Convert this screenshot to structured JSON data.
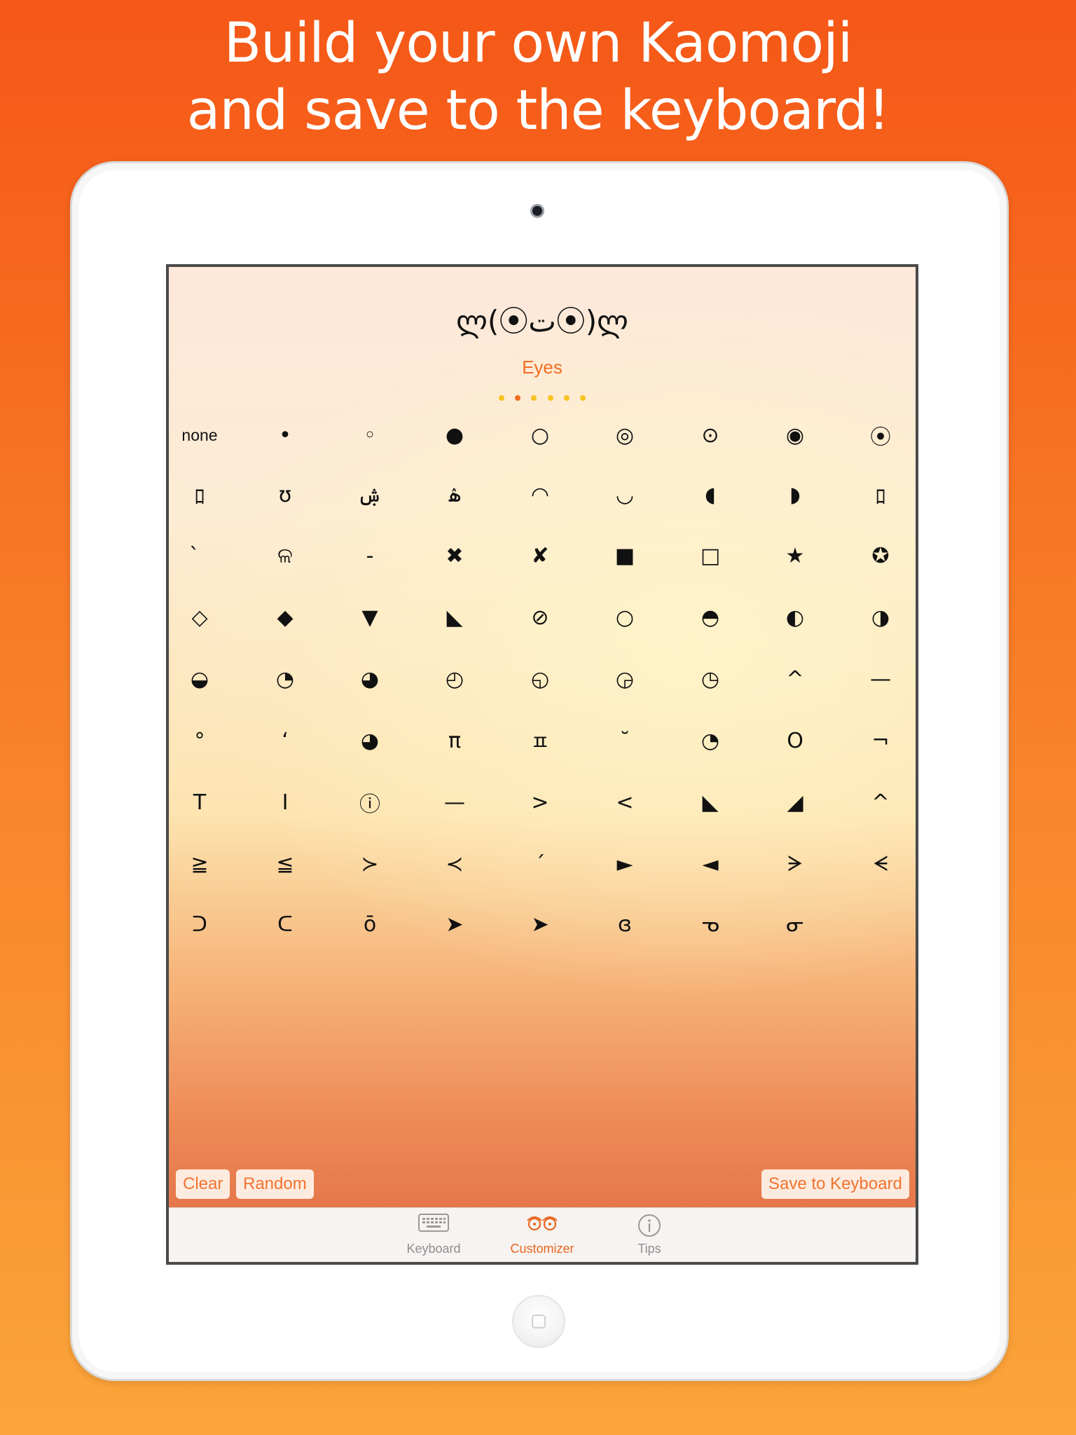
{
  "headline": {
    "line1": "Build your own Kaomoji",
    "line2": "and save to the keyboard!"
  },
  "preview_kaomoji": "ლ(⦿ت⦿)ლ",
  "section": {
    "label": "Eyes",
    "page_count": 6,
    "active_page_index": 1
  },
  "eyes": [
    [
      "none",
      "•",
      "◦",
      "●",
      "○",
      "◎",
      "⊙",
      "◉",
      "⦿"
    ],
    [
      "ﾛ",
      "ʊ",
      "ۺ",
      "ۿ",
      "◠",
      "◡",
      "◖",
      "◗",
      "ﾛ"
    ],
    [
      "̀",
      "ଳ",
      "-",
      "✖",
      "✘",
      "■",
      "□",
      "★",
      "✪"
    ],
    [
      "◇",
      "◆",
      "▼",
      "◣",
      "⊘",
      "○",
      "◓",
      "◐",
      "◑"
    ],
    [
      "◒",
      "◔",
      "◕",
      "◴",
      "◵",
      "◶",
      "◷",
      "^",
      "—"
    ],
    [
      "°",
      "‘",
      "◕",
      "π",
      "ㅍ",
      "˘",
      "◔",
      "O",
      "¬"
    ],
    [
      "T",
      "I",
      "ⓘ",
      "—",
      ">",
      "<",
      "◣",
      "◢",
      "^"
    ],
    [
      "≧",
      "≦",
      "≻",
      "≺",
      "ˊ",
      "►",
      "◄",
      "ᗒ",
      "ᗕ"
    ],
    [
      "ᑐ",
      "ᑕ",
      "ō",
      "➤",
      "➤",
      "ɞ",
      "ᓀ",
      "ᓂ"
    ]
  ],
  "buttons": {
    "clear": "Clear",
    "random": "Random",
    "save": "Save to Keyboard"
  },
  "tabbar": {
    "tabs": [
      {
        "label": "Keyboard",
        "icon": "keyboard-icon",
        "active": false
      },
      {
        "label": "Customizer",
        "icon": "eyes-icon",
        "active": true
      },
      {
        "label": "Tips",
        "icon": "info-icon",
        "active": false
      }
    ]
  },
  "colors": {
    "accent": "#f06d24",
    "dot": "#f7c320",
    "background_top": "#f55717",
    "background_bottom": "#fba53a"
  }
}
